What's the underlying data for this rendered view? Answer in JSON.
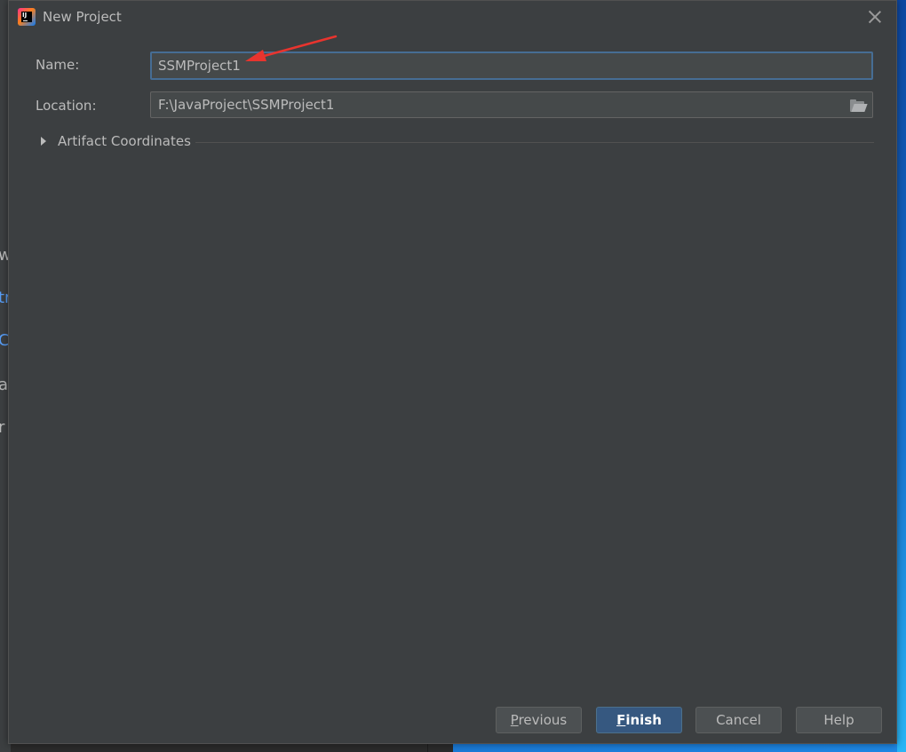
{
  "background": {
    "left_fragments": [
      "w",
      "tr",
      "C",
      "a",
      "r"
    ]
  },
  "dialog": {
    "title": "New Project",
    "app_icon_text": "IJ",
    "name_label": "Name:",
    "name_value": "SSMProject1",
    "location_label": "Location:",
    "location_value": "F:\\JavaProject\\SSMProject1",
    "artifact_section": "Artifact Coordinates",
    "buttons": {
      "previous_mnemonic": "P",
      "previous_rest": "revious",
      "finish_mnemonic": "F",
      "finish_rest": "inish",
      "cancel": "Cancel",
      "help": "Help"
    }
  },
  "colors": {
    "dialog_bg": "#3c3f41",
    "input_bg": "#45494a",
    "focus_border": "#466d94",
    "primary_button": "#365880",
    "text": "#bbbbbb",
    "annotation_arrow": "#e8342e"
  },
  "icons": [
    "intellij-icon",
    "close-icon",
    "folder-icon",
    "expand-triangle-icon"
  ]
}
